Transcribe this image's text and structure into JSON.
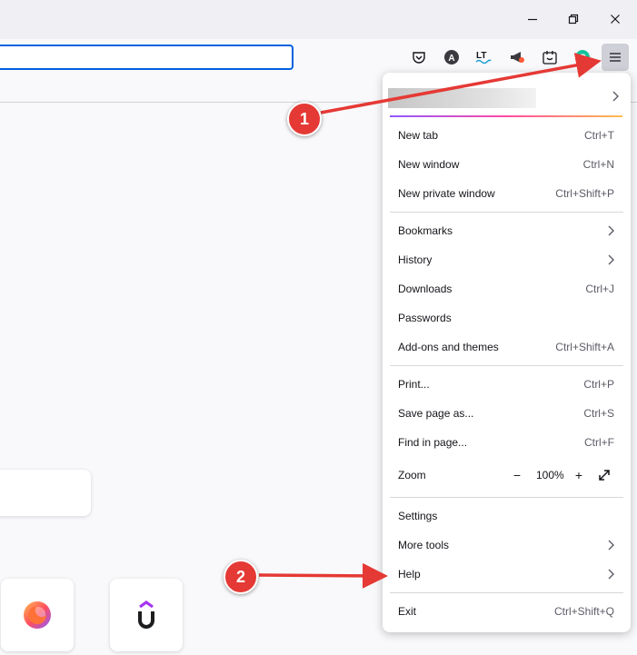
{
  "window_controls": {
    "minimize_icon": "minimize-icon",
    "restore_icon": "restore-icon",
    "close_icon": "close-icon"
  },
  "toolbar": {
    "extensions": [
      "pocket-icon",
      "account-a-icon",
      "languagetool-icon",
      "megaphone-icon",
      "screenshot-icon",
      "grammarly-icon"
    ],
    "menu_button_icon": "hamburger-icon"
  },
  "menu": {
    "account_accent": [
      "#9059ff",
      "#ff4aa2",
      "#ffbd4f"
    ],
    "group1": [
      {
        "label": "New tab",
        "shortcut": "Ctrl+T"
      },
      {
        "label": "New window",
        "shortcut": "Ctrl+N"
      },
      {
        "label": "New private window",
        "shortcut": "Ctrl+Shift+P"
      }
    ],
    "group2": [
      {
        "label": "Bookmarks"
      },
      {
        "label": "History"
      },
      {
        "label": "Downloads",
        "shortcut": "Ctrl+J"
      },
      {
        "label": "Passwords"
      },
      {
        "label": "Add-ons and themes",
        "shortcut": "Ctrl+Shift+A"
      }
    ],
    "group3": [
      {
        "label": "Print...",
        "shortcut": "Ctrl+P"
      },
      {
        "label": "Save page as...",
        "shortcut": "Ctrl+S"
      },
      {
        "label": "Find in page...",
        "shortcut": "Ctrl+F"
      }
    ],
    "zoom": {
      "label": "Zoom",
      "minus": "−",
      "value": "100%",
      "plus": "+",
      "fullscreen_icon": "fullscreen-icon"
    },
    "group4": [
      {
        "label": "Settings"
      },
      {
        "label": "More tools"
      },
      {
        "label": "Help"
      }
    ],
    "exit": {
      "label": "Exit",
      "shortcut": "Ctrl+Shift+Q"
    }
  },
  "annotations": {
    "step1": "1",
    "step2": "2",
    "color": "#e53935"
  },
  "tiles": [
    "firefox-logo-icon",
    "udemy-logo-icon"
  ]
}
